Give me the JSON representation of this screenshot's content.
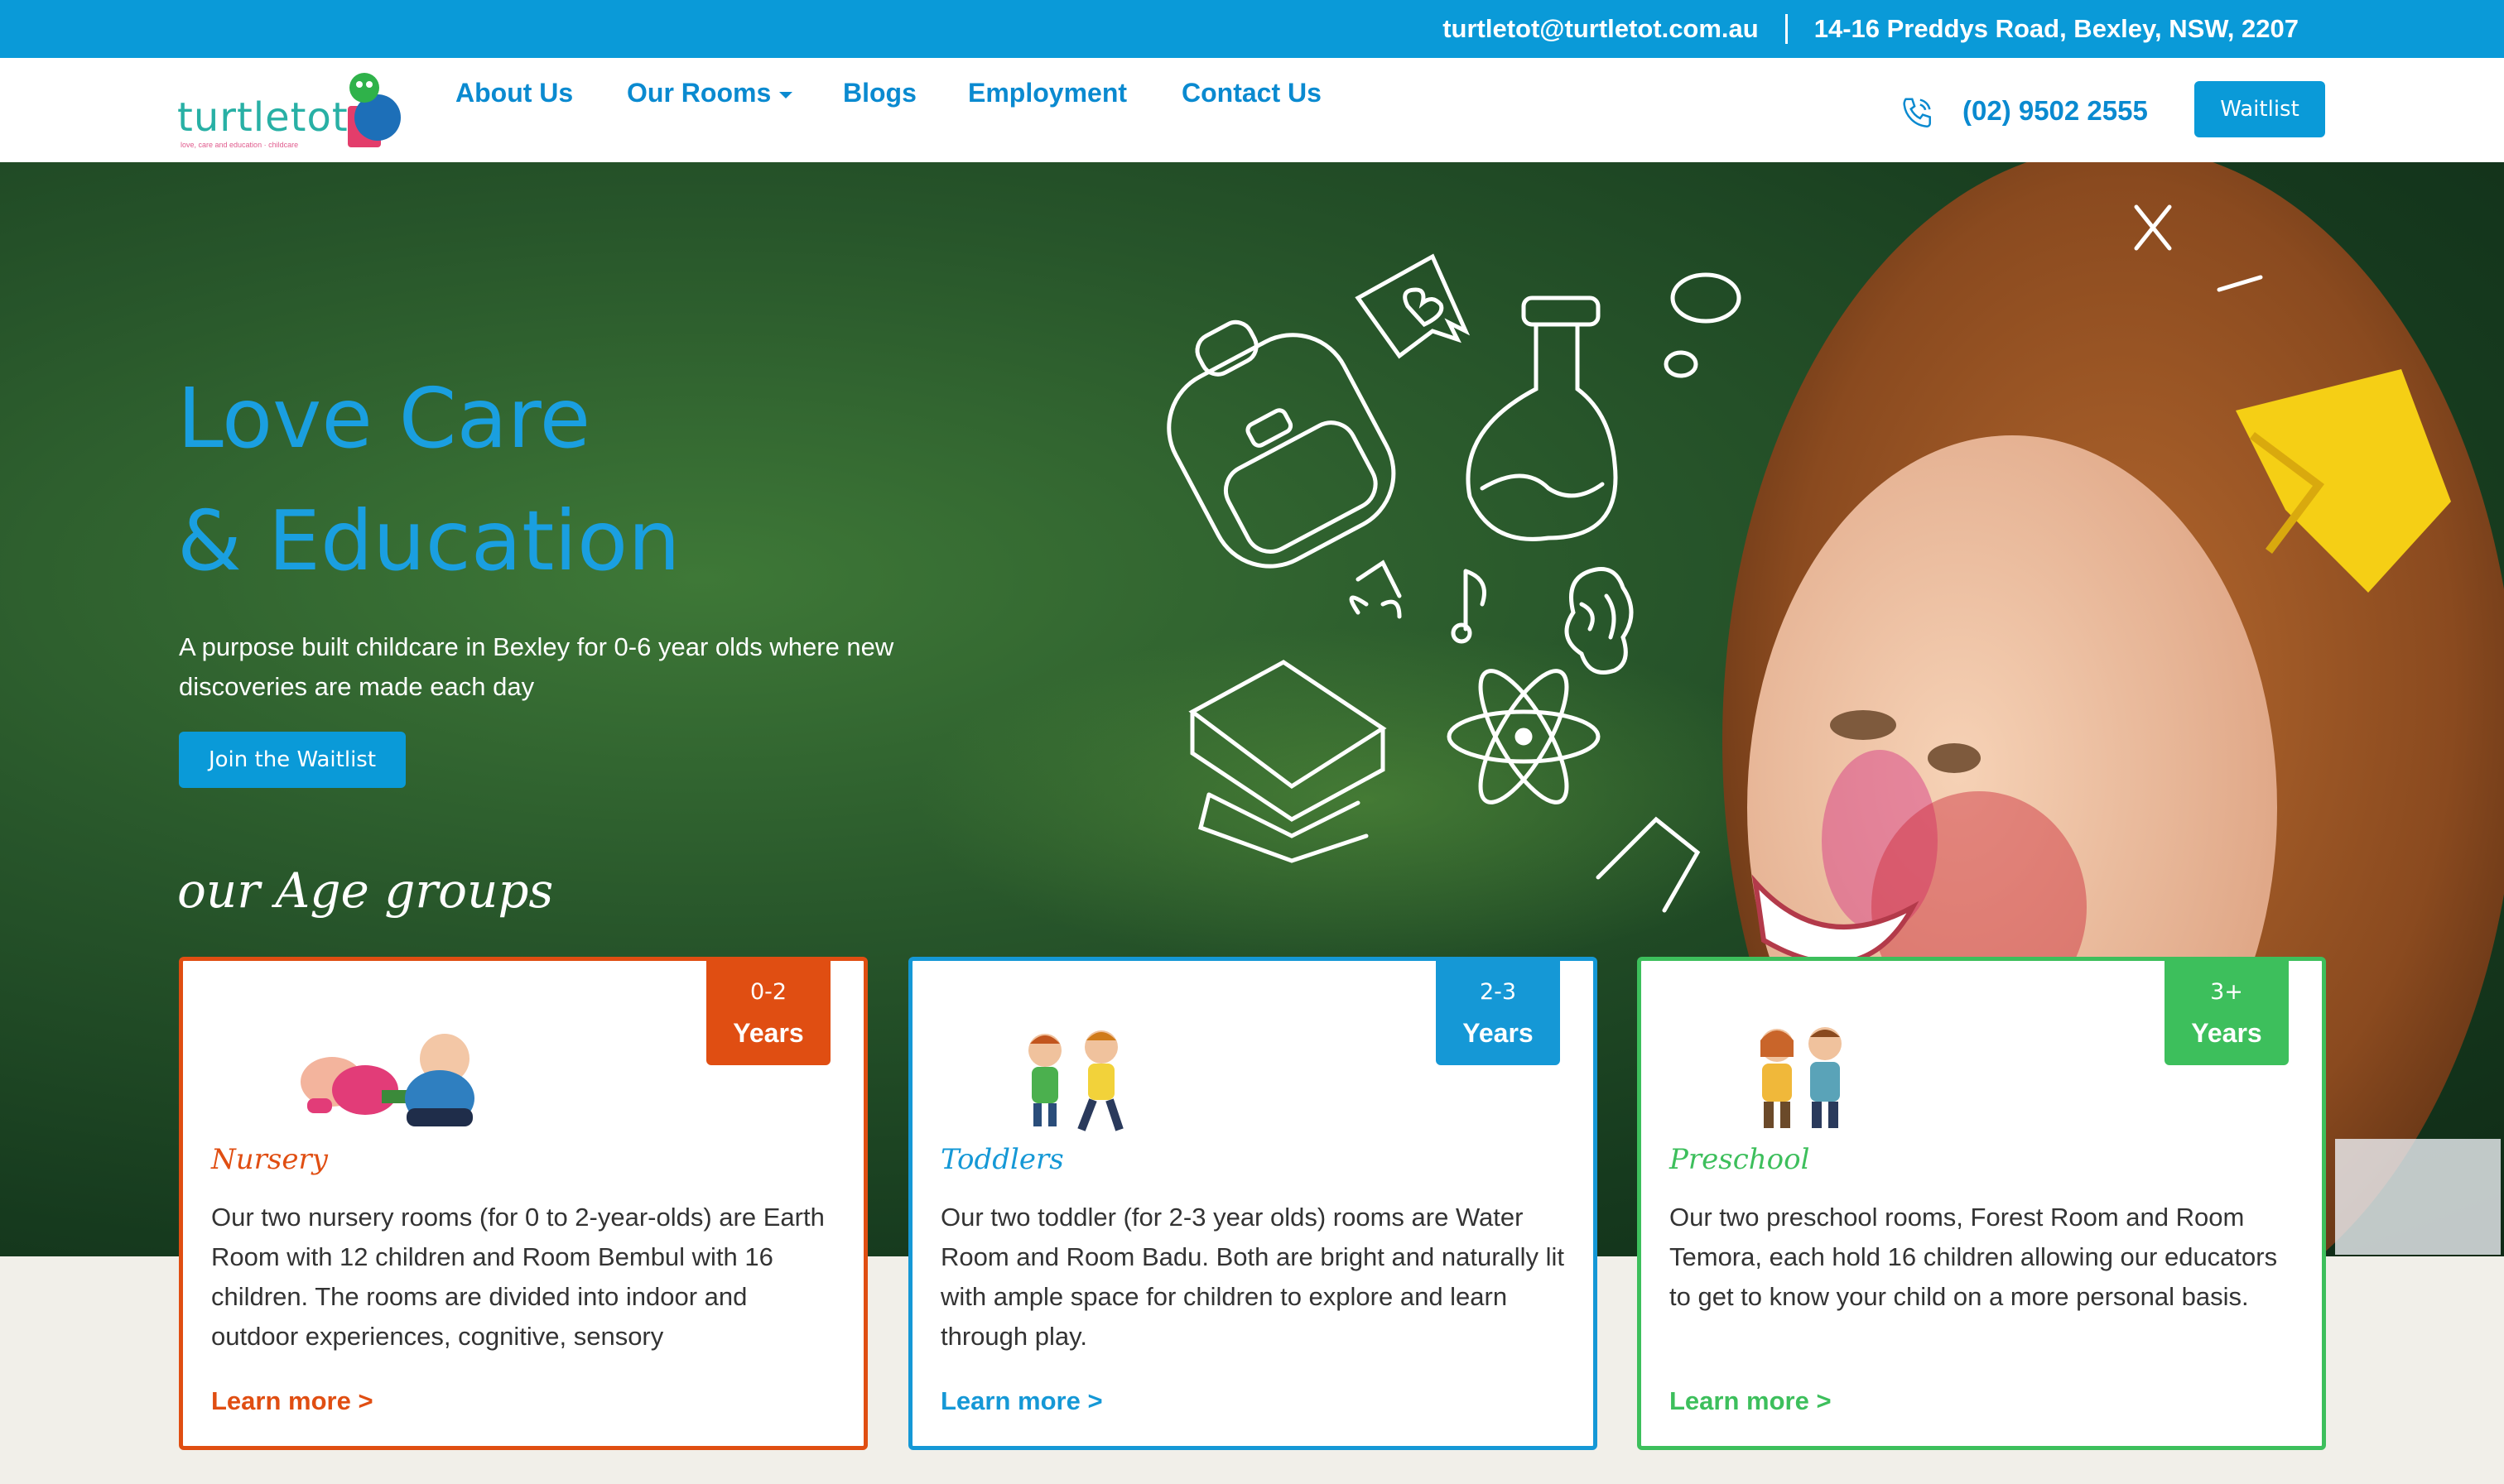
{
  "topbar": {
    "email": "turtletot@turtletot.com.au",
    "address": "14-16 Preddys Road, Bexley, NSW, 2207"
  },
  "logo": {
    "text": "turtletot",
    "tagline": "love, care and education · childcare"
  },
  "nav": {
    "items": [
      {
        "label": "About Us"
      },
      {
        "label": "Our Rooms"
      },
      {
        "label": "Blogs"
      },
      {
        "label": "Employment"
      },
      {
        "label": "Contact Us"
      }
    ],
    "phone": "(02) 9502 2555",
    "waitlist_label": "Waitlist"
  },
  "hero": {
    "title_line1": "Love Care",
    "title_line2": "& Education",
    "subtitle": "A purpose built childcare in Bexley for 0-6 year olds where new discoveries are made each day",
    "cta_label": "Join the Waitlist",
    "age_heading": "our Age groups"
  },
  "cards": [
    {
      "range": "0-2",
      "years": "Years",
      "title": "Nursery",
      "text": "Our two nursery rooms (for 0 to 2-year-olds) are Earth Room with 12 children and Room Bembul with 16 children. The rooms are divided into indoor and outdoor experiences, cognitive, sensory",
      "link": "Learn more >",
      "color": "#e04e12"
    },
    {
      "range": "2-3",
      "years": "Years",
      "title": "Toddlers",
      "text": "Our two toddler (for 2-3 year olds) rooms are Water Room and Room Badu. Both are bright and naturally lit with ample space for children to explore and learn through play.",
      "link": "Learn more >",
      "color": "#1598d6"
    },
    {
      "range": "3+",
      "years": "Years",
      "title": "Preschool",
      "text": "Our two preschool rooms, Forest Room and Room Temora, each hold 16 children allowing our educators to get to know your child on a more personal basis.",
      "link": "Learn more >",
      "color": "#3dbf5c"
    }
  ],
  "colors": {
    "brand_blue": "#0a9ad8",
    "nursery": "#e04e12",
    "toddlers": "#1598d6",
    "preschool": "#3dbf5c"
  }
}
